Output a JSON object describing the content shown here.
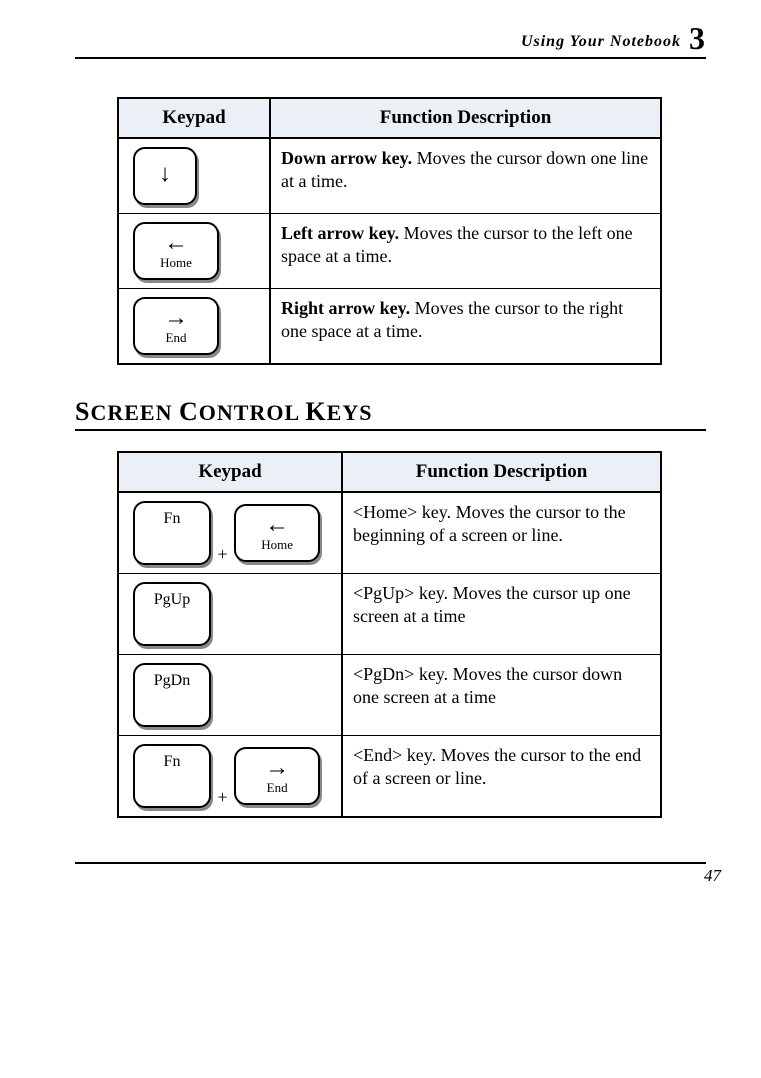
{
  "header": {
    "running_title": "Using Your Notebook",
    "chapter_no": "3"
  },
  "table1": {
    "th_keypad": "Keypad",
    "th_desc": "Function Description",
    "rows": [
      {
        "desc_bold": "Down arrow key.",
        "desc_rest": " Moves the cursor down one line at a time.",
        "key": {
          "arrow": "↓",
          "sub": ""
        }
      },
      {
        "desc_bold": "Left arrow key.",
        "desc_rest": " Moves the cursor to the left one space at a time.",
        "key": {
          "arrow": "←",
          "sub": "Home"
        }
      },
      {
        "desc_bold": "Right arrow key.",
        "desc_rest": " Moves the cursor to the right one space at a time.",
        "key": {
          "arrow": "→",
          "sub": "End"
        }
      }
    ]
  },
  "section_heading": "Screen Control Keys",
  "table2": {
    "th_keypad": "Keypad",
    "th_desc": "Function Description",
    "rows": [
      {
        "desc": "<Home> key. Moves the cursor to the beginning of a screen or line.",
        "keys": [
          {
            "label": "Fn"
          },
          {
            "arrow": "←",
            "sub": "Home"
          }
        ],
        "plus": "+"
      },
      {
        "desc": "<PgUp> key. Moves the cursor up one screen at a time",
        "keys": [
          {
            "label": "PgUp"
          }
        ]
      },
      {
        "desc": "<PgDn> key. Moves the cursor down one screen at a time",
        "keys": [
          {
            "label": "PgDn"
          }
        ]
      },
      {
        "desc": "<End> key. Moves the cursor to the end of a screen or line.",
        "keys": [
          {
            "label": "Fn"
          },
          {
            "arrow": "→",
            "sub": "End"
          }
        ],
        "plus": "+"
      }
    ]
  },
  "footer": {
    "page": "47"
  }
}
